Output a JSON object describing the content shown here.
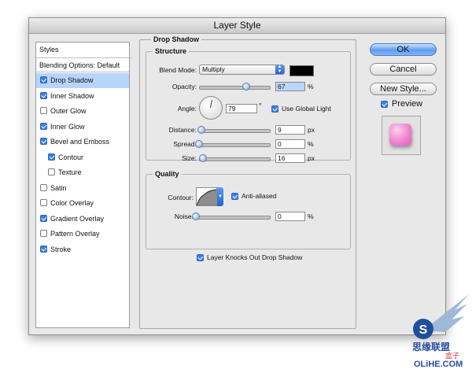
{
  "window": {
    "title": "Layer Style"
  },
  "styles_list": {
    "header": "Styles",
    "blending_options": "Blending Options: Default",
    "items": [
      {
        "label": "Drop Shadow",
        "checked": true,
        "selected": true
      },
      {
        "label": "Inner Shadow",
        "checked": true,
        "selected": false
      },
      {
        "label": "Outer Glow",
        "checked": false,
        "selected": false
      },
      {
        "label": "Inner Glow",
        "checked": true,
        "selected": false
      },
      {
        "label": "Bevel and Emboss",
        "checked": true,
        "selected": false
      },
      {
        "label": "Contour",
        "checked": true,
        "selected": false,
        "indent": true
      },
      {
        "label": "Texture",
        "checked": false,
        "selected": false,
        "indent": true
      },
      {
        "label": "Satin",
        "checked": false,
        "selected": false
      },
      {
        "label": "Color Overlay",
        "checked": false,
        "selected": false
      },
      {
        "label": "Gradient Overlay",
        "checked": true,
        "selected": false
      },
      {
        "label": "Pattern Overlay",
        "checked": false,
        "selected": false
      },
      {
        "label": "Stroke",
        "checked": true,
        "selected": false
      }
    ]
  },
  "panel": {
    "title": "Drop Shadow",
    "structure": {
      "legend": "Structure",
      "blend_mode_label": "Blend Mode:",
      "blend_mode_value": "Multiply",
      "shadow_color": "#000000",
      "opacity_label": "Opacity:",
      "opacity_value": "67",
      "opacity_unit": "%",
      "opacity_fraction": 0.67,
      "angle_label": "Angle:",
      "angle_value": "79",
      "angle_unit": "°",
      "use_global_light_label": "Use Global Light",
      "use_global_light_checked": true,
      "distance_label": "Distance:",
      "distance_value": "9",
      "distance_unit": "px",
      "distance_fraction": 0.03,
      "spread_label": "Spread:",
      "spread_value": "0",
      "spread_unit": "%",
      "spread_fraction": 0.0,
      "size_label": "Size:",
      "size_value": "16",
      "size_unit": "px",
      "size_fraction": 0.06
    },
    "quality": {
      "legend": "Quality",
      "contour_label": "Contour:",
      "anti_aliased_label": "Anti-aliased",
      "anti_aliased_checked": true,
      "noise_label": "Noise:",
      "noise_value": "0",
      "noise_unit": "%",
      "noise_fraction": 0.0
    },
    "knockout_label": "Layer Knocks Out Drop Shadow",
    "knockout_checked": true
  },
  "buttons": {
    "ok": "OK",
    "cancel": "Cancel",
    "new_style": "New Style..."
  },
  "preview": {
    "label": "Preview",
    "checked": true
  },
  "watermark": {
    "text_top": "思缘联盟",
    "text_bottom": "OLiHE.COM",
    "text_box": "盒子"
  },
  "colors": {
    "selection": "#b5d5fb",
    "accent_blue": "#3b7fe0",
    "preview_pink": "#ef7fcc"
  }
}
